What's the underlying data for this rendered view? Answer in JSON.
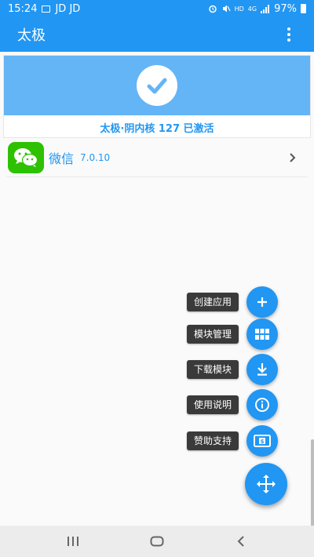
{
  "status_bar": {
    "time": "15:24",
    "carrier": "JD JD",
    "network_small": "HD",
    "network_type": "4G",
    "battery": "97%"
  },
  "app_bar": {
    "title": "太极",
    "overflow_icon": "more-vert-icon"
  },
  "status_card": {
    "icon": "check-icon",
    "text": "太极·阴内核 127 已激活",
    "banner_color": "#64b5f6"
  },
  "modules": [
    {
      "name": "微信",
      "version": "7.0.10",
      "icon": "wechat-icon"
    }
  ],
  "fab_menu": [
    {
      "label": "创建应用",
      "icon": "plus-icon"
    },
    {
      "label": "模块管理",
      "icon": "grid-icon"
    },
    {
      "label": "下载模块",
      "icon": "download-icon"
    },
    {
      "label": "使用说明",
      "icon": "info-icon"
    },
    {
      "label": "赞助支持",
      "icon": "donate-icon"
    }
  ],
  "fab_main": {
    "icon": "move-arrows-icon"
  },
  "colors": {
    "primary": "#2196f3",
    "wechat_green": "#2dc100",
    "label_bg": "#3a3a3a"
  },
  "nav_bar": {
    "recent_icon": "recents-icon",
    "home_icon": "home-icon",
    "back_icon": "back-icon"
  }
}
